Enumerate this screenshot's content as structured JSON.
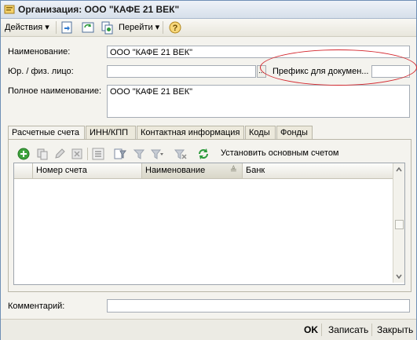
{
  "window": {
    "title": "Организация: ООО \"КАФЕ 21 ВЕК\""
  },
  "toolbar": {
    "actions_label": "Действия",
    "goto_label": "Перейти"
  },
  "form": {
    "name_label": "Наименование:",
    "name_value": "ООО \"КАФЕ 21 ВЕК\"",
    "entity_label": "Юр. / физ. лицо:",
    "entity_value": "",
    "prefix_label": "Префикс для докумен...",
    "prefix_value": "",
    "fullname_label": "Полное наименование:",
    "fullname_value": "ООО \"КАФЕ 21 ВЕК\"",
    "comment_label": "Комментарий:",
    "comment_value": ""
  },
  "tabs": [
    "Расчетные счета",
    "ИНН/КПП",
    "Контактная информация",
    "Коды",
    "Фонды"
  ],
  "grid": {
    "set_main_label": "Установить основным счетом",
    "columns": [
      "Номер счета",
      "Наименование",
      "Банк"
    ]
  },
  "footer": {
    "ok": "OK",
    "save": "Записать",
    "close": "Закрыть"
  },
  "colors": {
    "annotation": "#d3252c"
  }
}
